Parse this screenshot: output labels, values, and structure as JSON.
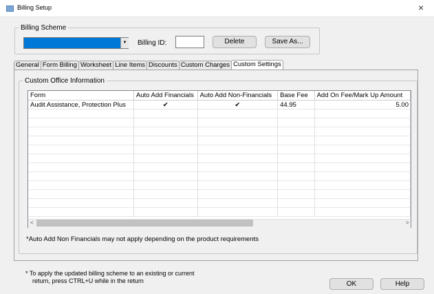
{
  "window": {
    "title": "Billing Setup",
    "close_glyph": "×"
  },
  "billing_scheme": {
    "legend": "Billing Scheme",
    "selected_value": "",
    "billing_id_label": "Billing ID:",
    "billing_id_value": "",
    "delete_label": "Delete",
    "save_as_label": "Save As..."
  },
  "tabs": [
    {
      "label": "General",
      "active": false
    },
    {
      "label": "Form Billing",
      "active": false
    },
    {
      "label": "Worksheet",
      "active": false
    },
    {
      "label": "Line Items",
      "active": false
    },
    {
      "label": "Discounts",
      "active": false
    },
    {
      "label": "Custom Charges",
      "active": false
    },
    {
      "label": "Custom Settings",
      "active": true
    }
  ],
  "custom_office": {
    "legend": "Custom Office Information",
    "columns": [
      "Form",
      "Auto Add Financials",
      "Auto Add Non-Financials",
      "Base Fee",
      "Add On Fee/Mark Up Amount"
    ],
    "rows": [
      {
        "form": "Audit Assistance, Protection Plus",
        "auto_fin": "✔",
        "auto_nonfin": "✔",
        "base_fee": "44.95",
        "add_on": "5.00"
      }
    ],
    "note": "*Auto Add Non Financials may not apply depending on the product requirements"
  },
  "footer": {
    "note_line1": "* To apply the updated billing scheme to an existing or current",
    "note_line2": "return, press CTRL+U while in the return",
    "ok_label": "OK",
    "help_label": "Help"
  },
  "colors": {
    "selection": "#0078d7",
    "window_bg": "#f0f0f0"
  }
}
